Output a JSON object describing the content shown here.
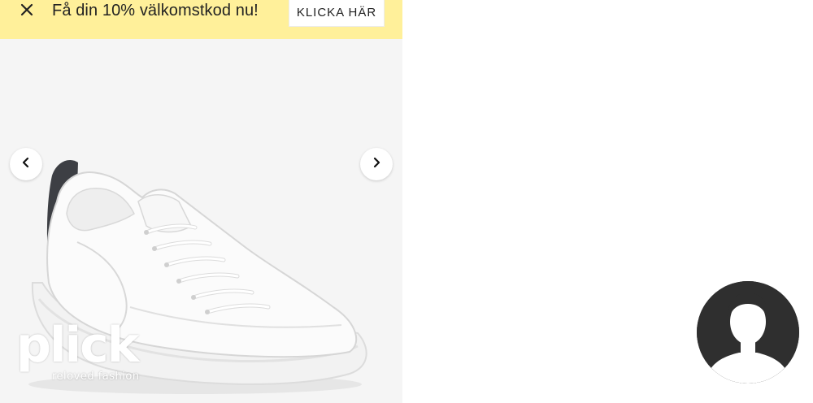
{
  "promo": {
    "text": "Få din 10% välkomstkod nu!",
    "cta_label": "KLICKA HÄR",
    "background_color": "#fff09a",
    "close_icon": "close-icon"
  },
  "product": {
    "image_alt": "White leather platform sneaker",
    "prev_icon": "chevron-left-icon",
    "next_icon": "chevron-right-icon"
  },
  "brand": {
    "name": "plick",
    "tagline": "reloved fashion"
  },
  "user": {
    "avatar_icon": "user-silhouette-icon"
  }
}
